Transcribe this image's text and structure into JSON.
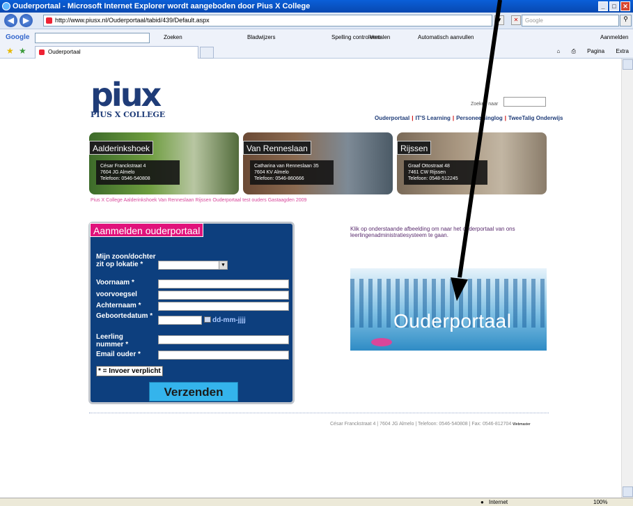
{
  "window": {
    "title": "Ouderportaal - Microsoft Internet Explorer wordt aangeboden door Pius X College",
    "min": "_",
    "max": "□",
    "close": "✕"
  },
  "address": {
    "url": "http://www.piusx.nl/Ouderportaal/tabid/439/Default.aspx",
    "search_placeholder": "Google"
  },
  "toolbar": {
    "google_logo": "Google",
    "zoeken": "Zoeken",
    "bladwijzers": "Bladwijzers",
    "spelling": "Spelling controleren",
    "vertalen": "Vertalen",
    "automatisch": "Automatisch aanvullen",
    "aanmelden": "Aanmelden"
  },
  "tab": {
    "label": "Ouderportaal"
  },
  "tools": {
    "pagina": "Pagina",
    "extra": "Extra"
  },
  "site": {
    "logo_mark": "piux",
    "logo_text": "PIUS X COLLEGE",
    "search_label": "Zoeken naar",
    "nav": [
      "Ouderportaal",
      "IT'S Learning",
      "Personeelsinglog",
      "TweeTalig Onderwijs"
    ],
    "locations": [
      {
        "name": "Aalderinkshoek",
        "addr1": "César Franckstraat 4",
        "addr2": "7604 JG Almelo",
        "phone": "Telefoon: 0546-540808"
      },
      {
        "name": "Van Renneslaan",
        "addr1": "Catharina van Renneslaan 35",
        "addr2": "7604 KV Almelo",
        "phone": "Telefoon: 0546-860666"
      },
      {
        "name": "Rijssen",
        "addr1": "Graaf Ottostraat 48",
        "addr2": "7461 CW Rijssen",
        "phone": "Telefoon: 0548-512245"
      }
    ],
    "breadcrumb": "Pius X College  Aalderinkshoek  Van Renneslaan  Rijssen  Ouderportaal  test ouders  Gastaagden 2009",
    "form": {
      "title": "Aanmelden ouderportaal",
      "label_child": "Mijn zoon/dochter zit op lokatie *",
      "label_voornaam": "Voornaam *",
      "label_voorvoegsel": "voorvoegsel",
      "label_achternaam": "Achternaam *",
      "label_geboortedatum": "Geboortedatum *",
      "date_hint": "dd-mm-jjjj",
      "label_leerling": "Leerling nummer *",
      "label_email": "Email ouder *",
      "required_note": "* = Invoer verplicht",
      "submit": "Verzenden"
    },
    "intro": "Klik op onderstaande afbeelding om naar het ouderportaal van ons leerlingenadministratiesysteem te gaan.",
    "banner_word": "Ouderportaal",
    "footer": "César Franckstraat 4 | 7604 JG Almelo | Telefoon: 0546-540808 | Fax: 0546-812704",
    "footer_wm": "Webmaster"
  },
  "status": {
    "zone": "Internet",
    "zoom": "100%"
  }
}
